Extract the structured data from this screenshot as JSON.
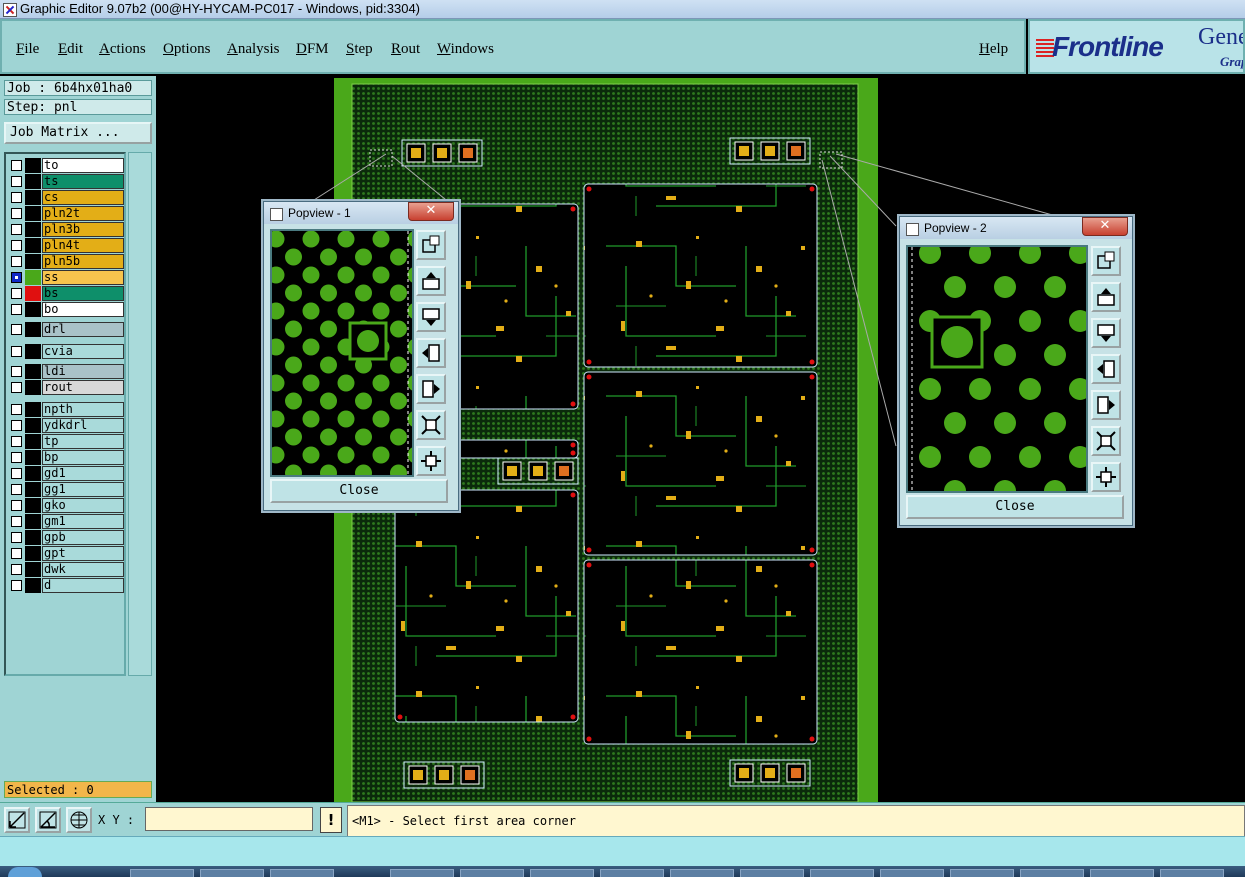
{
  "window": {
    "title": "Graphic Editor 9.07b2 (00@HY-HYCAM-PC017 - Windows, pid:3304)"
  },
  "menu": {
    "items": [
      "File",
      "Edit",
      "Actions",
      "Options",
      "Analysis",
      "DFM",
      "Step",
      "Rout",
      "Windows"
    ],
    "help": "Help"
  },
  "logo": {
    "brand": "Frontline",
    "product_partial": "Gene",
    "sub_partial": "Grap"
  },
  "job": {
    "label": "Job : 6b4hx01ha0",
    "step": "Step: pnl",
    "matrix_button": "Job Matrix ..."
  },
  "layers": [
    {
      "name": "to",
      "color": "#ffffff",
      "swatch": "#000000",
      "selected": false
    },
    {
      "name": "ts",
      "color": "#0e8f6a",
      "swatch": "#000000",
      "selected": false
    },
    {
      "name": "cs",
      "color": "#e3ae17",
      "swatch": "#000000",
      "selected": false
    },
    {
      "name": "pln2t",
      "color": "#e3ae17",
      "swatch": "#000000",
      "selected": false
    },
    {
      "name": "pln3b",
      "color": "#e3ae17",
      "swatch": "#000000",
      "selected": false
    },
    {
      "name": "pln4t",
      "color": "#e3ae17",
      "swatch": "#000000",
      "selected": false
    },
    {
      "name": "pln5b",
      "color": "#e3ae17",
      "swatch": "#000000",
      "selected": false
    },
    {
      "name": "ss",
      "color": "#f7c44d",
      "swatch": "#4aa81a",
      "selected": true
    },
    {
      "name": "bs",
      "color": "#0e8f6a",
      "swatch": "#e01010",
      "selected": false
    },
    {
      "name": "bo",
      "color": "#ffffff",
      "swatch": "#000000",
      "selected": false
    },
    {
      "name": "drl",
      "color": "#a9c2c8",
      "swatch": "#000000",
      "selected": false
    },
    {
      "name": "cvia",
      "color": "#a9dada",
      "swatch": "#000000",
      "selected": false
    },
    {
      "name": "ldi",
      "color": "#a9c2c8",
      "swatch": "#000000",
      "selected": false
    },
    {
      "name": "rout",
      "color": "#d8d8d8",
      "swatch": "#000000",
      "selected": false
    },
    {
      "name": "npth",
      "color": "#a9dada",
      "swatch": "#000000",
      "selected": false
    },
    {
      "name": "ydkdrl",
      "color": "#a9dada",
      "swatch": "#000000",
      "selected": false
    },
    {
      "name": "tp",
      "color": "#a9dada",
      "swatch": "#000000",
      "selected": false
    },
    {
      "name": "bp",
      "color": "#a9dada",
      "swatch": "#000000",
      "selected": false
    },
    {
      "name": "gd1",
      "color": "#a9dada",
      "swatch": "#000000",
      "selected": false
    },
    {
      "name": "gg1",
      "color": "#a9dada",
      "swatch": "#000000",
      "selected": false
    },
    {
      "name": "gko",
      "color": "#a9dada",
      "swatch": "#000000",
      "selected": false
    },
    {
      "name": "gm1",
      "color": "#a9dada",
      "swatch": "#000000",
      "selected": false
    },
    {
      "name": "gpb",
      "color": "#a9dada",
      "swatch": "#000000",
      "selected": false
    },
    {
      "name": "gpt",
      "color": "#a9dada",
      "swatch": "#000000",
      "selected": false
    },
    {
      "name": "dwk",
      "color": "#a9dada",
      "swatch": "#000000",
      "selected": false
    },
    {
      "name": "d",
      "color": "#a9dada",
      "swatch": "#000000",
      "selected": false
    }
  ],
  "selected_text": "Selected : 0",
  "popview1": {
    "title": "Popview - 1",
    "close_label": "Close",
    "close_glyph": "✕"
  },
  "popview2": {
    "title": "Popview - 2",
    "close_label": "Close",
    "close_glyph": "✕"
  },
  "bottom": {
    "xy_label": "X Y :",
    "xy_value": "",
    "warn_glyph": "!",
    "status": "<M1> - Select first area corner"
  },
  "colors": {
    "board_green": "#4aa81a",
    "copper": "#e3ae17",
    "trace_green": "#1f9a2a",
    "pad_red": "#e01010",
    "panel_teal": "#9fd4d4"
  }
}
